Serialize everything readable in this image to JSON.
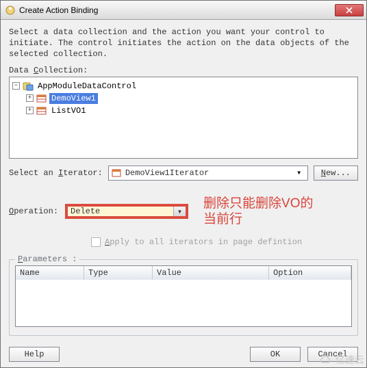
{
  "window": {
    "title": "Create Action Binding"
  },
  "instruction": "Select a data collection and the action you want your control to initiate. The control initiates the action on the data objects of the selected collection.",
  "data_collection": {
    "label": "Data Collection:",
    "underline_char": "C",
    "tree": {
      "root": {
        "label": "AppModuleDataControl",
        "icon": "data-control-icon",
        "expanded": true,
        "children": [
          {
            "label": "DemoView1",
            "icon": "view-object-icon",
            "selected": true
          },
          {
            "label": "ListVO1",
            "icon": "view-object-icon",
            "selected": false
          }
        ]
      }
    }
  },
  "iterator": {
    "label": "Select an Iterator:",
    "underline_char": "I",
    "selected": "DemoView1Iterator",
    "new_button": "New..."
  },
  "operation": {
    "label": "Operation:",
    "underline_char": "O",
    "selected": "Delete"
  },
  "annotation": {
    "line1": "删除只能删除VO的",
    "line2": "当前行"
  },
  "apply": {
    "label": "Apply to all iterators in page defintion",
    "underline_char": "A",
    "enabled": false
  },
  "parameters": {
    "title": "Parameters :",
    "underline_char": "P",
    "columns": [
      "Name",
      "Type",
      "Value",
      "Option"
    ]
  },
  "footer": {
    "help": "Help",
    "ok": "OK",
    "cancel": "Cancel"
  },
  "watermark": "亿速云"
}
